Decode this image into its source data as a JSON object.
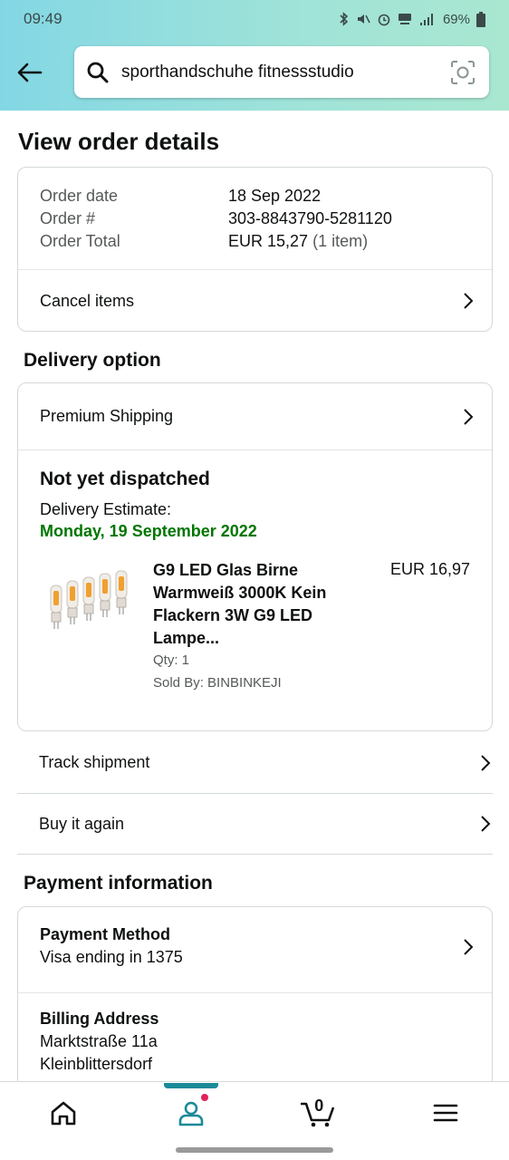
{
  "status_bar": {
    "time": "09:49",
    "battery": "69%"
  },
  "search": {
    "value": "sporthandschuhe fitnessstudio"
  },
  "page_title": "View order details",
  "order_summary": {
    "rows": [
      {
        "label": "Order date",
        "value": "18 Sep 2022",
        "extra": ""
      },
      {
        "label": "Order #",
        "value": "303-8843790-5281120",
        "extra": ""
      },
      {
        "label": "Order Total",
        "value": "EUR 15,27",
        "extra": "(1 item)"
      }
    ],
    "cancel_label": "Cancel items"
  },
  "delivery": {
    "section_title": "Delivery option",
    "option_label": "Premium Shipping",
    "status": "Not yet dispatched",
    "estimate_label": "Delivery Estimate:",
    "estimate_date": "Monday, 19 September 2022",
    "estimate_color": "#007600",
    "item": {
      "title_lines": [
        "G9 LED Glas Birne",
        "Warmweiß 3000K Kein",
        "Flackern 3W G9 LED",
        "Lampe..."
      ],
      "price": "EUR 16,97",
      "qty": "Qty: 1",
      "sold_by": "Sold By: BINBINKEJI"
    }
  },
  "actions": {
    "track": "Track shipment",
    "buy_again": "Buy it again"
  },
  "payment": {
    "section_title": "Payment information",
    "method_title": "Payment Method",
    "method_value": "Visa ending in 1375",
    "billing_title": "Billing Address",
    "billing_lines": [
      "Marktstraße 11a",
      "Kleinblittersdorf"
    ]
  },
  "bottom_nav": {
    "cart_count": "0"
  },
  "colors": {
    "accent": "#1a8a99",
    "header_start": "#83d7e4",
    "header_end": "#a9e7d0",
    "notification": "#e3215a"
  }
}
